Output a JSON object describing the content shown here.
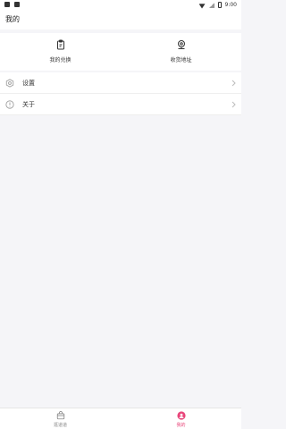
{
  "status_bar": {
    "time": "9:00"
  },
  "header": {
    "title": "我的"
  },
  "shortcuts": [
    {
      "label": "我的兑换",
      "icon": "clipboard-icon"
    },
    {
      "label": "收货地址",
      "icon": "location-pin-icon"
    }
  ],
  "menu": [
    {
      "label": "设置",
      "icon": "gear-icon"
    },
    {
      "label": "关于",
      "icon": "info-icon"
    }
  ],
  "tabbar": {
    "tabs": [
      {
        "label": "逛道道",
        "icon": "bag-icon",
        "active": false
      },
      {
        "label": "我的",
        "icon": "profile-icon",
        "active": true
      }
    ]
  },
  "colors": {
    "accent": "#e8457a",
    "background": "#f5f5f8"
  }
}
